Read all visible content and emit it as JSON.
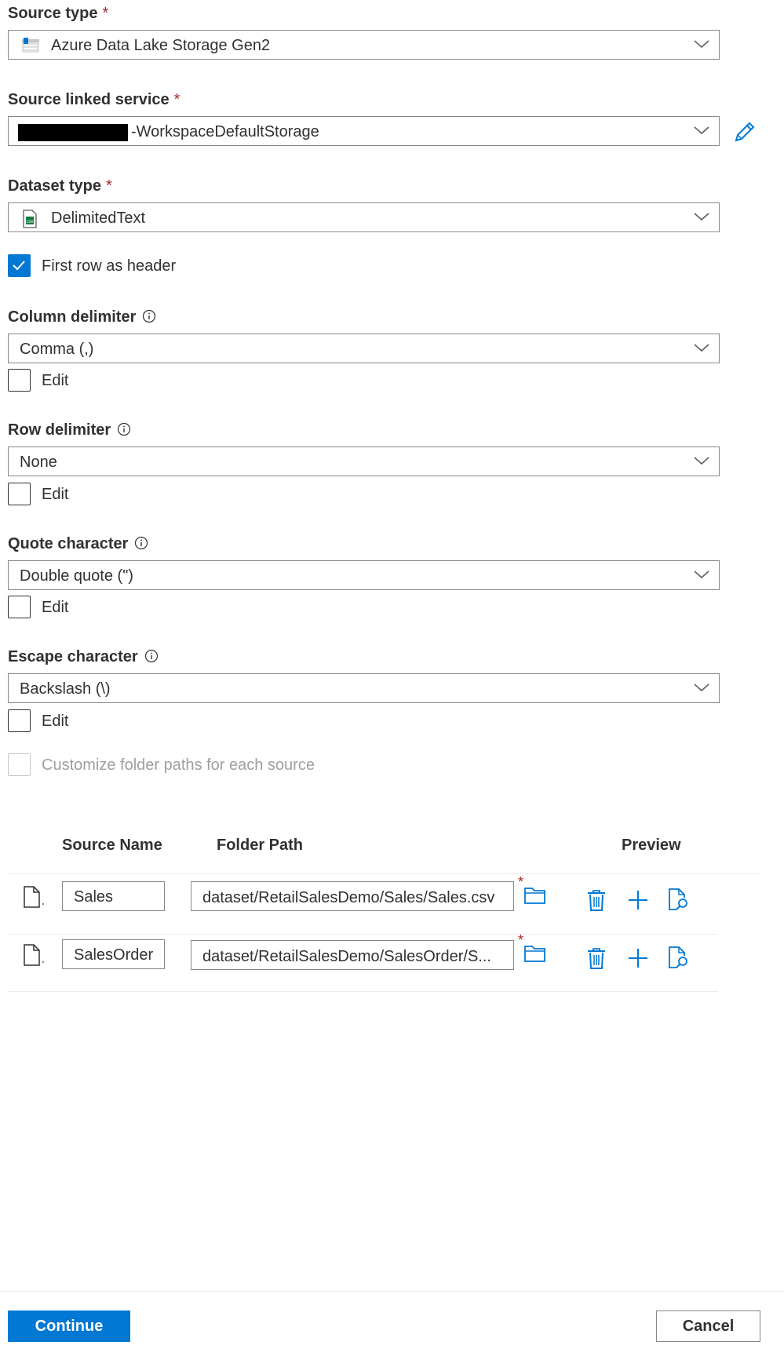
{
  "source_type": {
    "label": "Source type",
    "required_mark": "*",
    "value": "Azure Data Lake Storage Gen2",
    "icon": "storage-icon"
  },
  "linked_service": {
    "label": "Source linked service",
    "required_mark": "*",
    "value": "-WorkspaceDefaultStorage",
    "edit_icon": "pencil-icon"
  },
  "dataset_type": {
    "label": "Dataset type",
    "required_mark": "*",
    "value": "DelimitedText",
    "icon": "csv-file-icon"
  },
  "first_row_header": {
    "label": "First row as header",
    "checked": true
  },
  "column_delimiter": {
    "label": "Column delimiter",
    "value": "Comma (,)",
    "edit_label": "Edit"
  },
  "row_delimiter": {
    "label": "Row delimiter",
    "value": "None",
    "edit_label": "Edit"
  },
  "quote_character": {
    "label": "Quote character",
    "value": "Double quote (\")",
    "edit_label": "Edit"
  },
  "escape_character": {
    "label": "Escape character",
    "value": "Backslash (\\)",
    "edit_label": "Edit"
  },
  "customize_paths": {
    "label": "Customize folder paths for each source",
    "disabled": true
  },
  "table": {
    "headers": {
      "source_name": "Source Name",
      "folder_path": "Folder Path",
      "preview": "Preview"
    },
    "rows": [
      {
        "name": "Sales",
        "path": "dataset/RetailSalesDemo/Sales/Sales.csv",
        "required_mark": "*"
      },
      {
        "name": "SalesOrder",
        "path": "dataset/RetailSalesDemo/SalesOrder/S...",
        "required_mark": "*"
      }
    ]
  },
  "footer": {
    "continue": "Continue",
    "cancel": "Cancel"
  },
  "colors": {
    "accent": "#0078d4",
    "required": "#a4262c",
    "border": "#8a8886"
  }
}
